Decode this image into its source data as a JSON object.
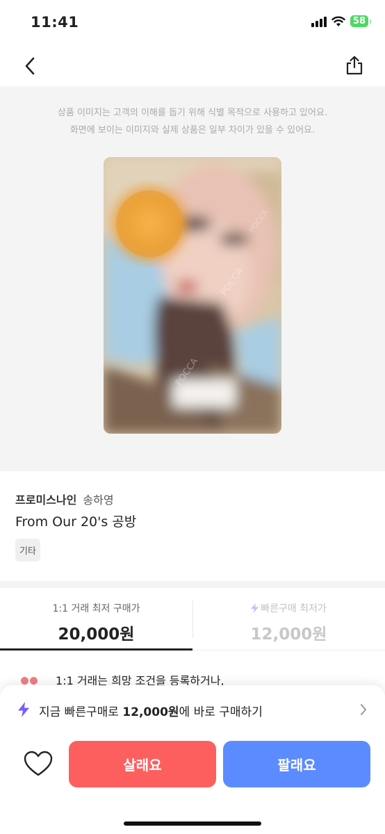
{
  "status_bar": {
    "time": "11:41",
    "battery": "58"
  },
  "nav": {
    "back_icon": "chevron-left-icon",
    "share_icon": "share-icon"
  },
  "image_notice": {
    "line1": "상품 이미지는 고객의 이해를 돕기 위해 식별 목적으로 사용하고 있어요.",
    "line2": "화면에 보이는 이미지와 실제 상품은 일부 차이가 있을 수 있어요."
  },
  "product": {
    "brand": "프로미스나인",
    "artist": "송하영",
    "title": "From Our 20's 공방",
    "tag": "기타"
  },
  "price_tabs": [
    {
      "label": "1:1 거래 최저 구매가",
      "price": "20,000원",
      "active": true
    },
    {
      "label": "빠른구매 최저가",
      "price": "12,000원",
      "active": false
    }
  ],
  "peek_text": "1:1 거래는 희망 조건을 등록하거나,",
  "quick_buy": {
    "prefix": "지금 빠른구매로 ",
    "amount": "12,000원",
    "suffix": "에 바로 구매하기"
  },
  "actions": {
    "buy_label": "살래요",
    "sell_label": "팔래요"
  },
  "colors": {
    "buy": "#fd5f5f",
    "sell": "#5c8bff",
    "bolt": "#7b5cff",
    "battery": "#4cd964"
  }
}
